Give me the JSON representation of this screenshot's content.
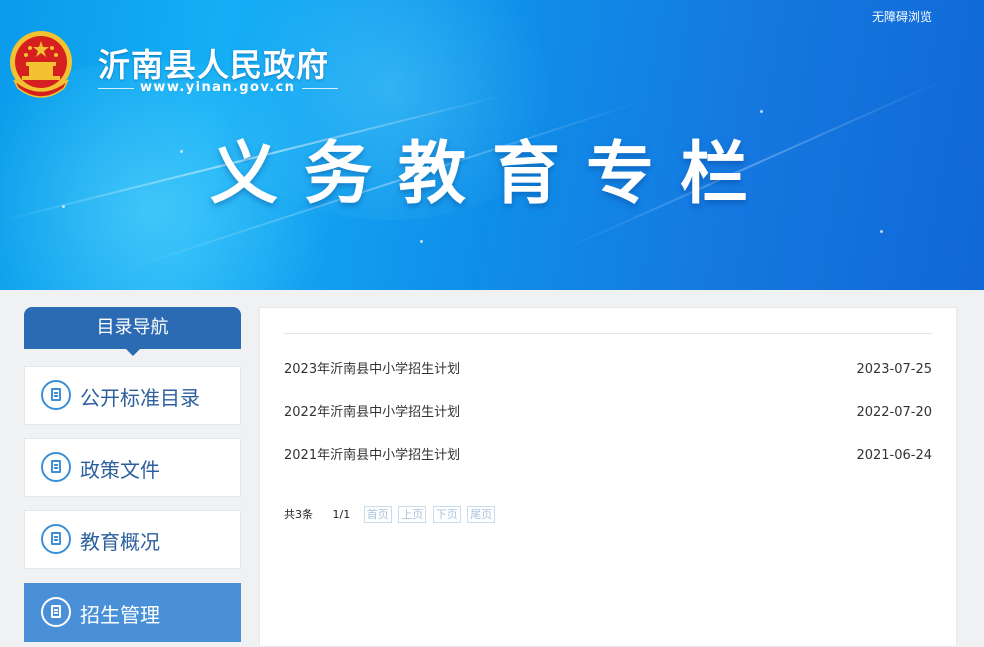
{
  "header": {
    "accessibility_link": "无障碍浏览",
    "site_name": "沂南县人民政府",
    "site_url": "www.yinan.gov.cn",
    "column_title": "义务教育专栏"
  },
  "sidebar": {
    "heading": "目录导航",
    "items": [
      {
        "label": "公开标准目录",
        "active": false
      },
      {
        "label": "政策文件",
        "active": false
      },
      {
        "label": "教育概况",
        "active": false
      },
      {
        "label": "招生管理",
        "active": true
      }
    ]
  },
  "list": {
    "items": [
      {
        "title": "2023年沂南县中小学招生计划",
        "date": "2023-07-25"
      },
      {
        "title": "2022年沂南县中小学招生计划",
        "date": "2022-07-20"
      },
      {
        "title": "2021年沂南县中小学招生计划",
        "date": "2021-06-24"
      }
    ]
  },
  "pager": {
    "total": "共3条",
    "page": "1/1",
    "first": "首页",
    "prev": "上页",
    "next": "下页",
    "last": "尾页"
  },
  "colors": {
    "banner_blue": "#0f8fe9",
    "nav_head": "#2b6bb3",
    "nav_active": "#4a90d9",
    "nav_text": "#2c5f9e",
    "emblem_red": "#d62020",
    "emblem_gold": "#f2c230"
  },
  "icons": [
    "national-emblem-icon",
    "document-icon"
  ]
}
